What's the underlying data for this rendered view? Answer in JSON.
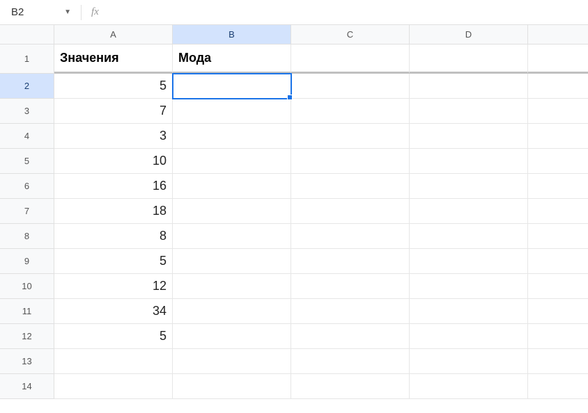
{
  "formulaBar": {
    "nameBox": "B2",
    "fx": "fx",
    "formula": ""
  },
  "columns": [
    "A",
    "B",
    "C",
    "D",
    ""
  ],
  "activeColumnIndex": 1,
  "activeRow": 2,
  "selectedCell": "B2",
  "rows": [
    {
      "n": 1,
      "header": true,
      "A": "Значения",
      "B": "Мода",
      "C": "",
      "D": ""
    },
    {
      "n": 2,
      "A": "5",
      "B": "",
      "C": "",
      "D": ""
    },
    {
      "n": 3,
      "A": "7",
      "B": "",
      "C": "",
      "D": ""
    },
    {
      "n": 4,
      "A": "3",
      "B": "",
      "C": "",
      "D": ""
    },
    {
      "n": 5,
      "A": "10",
      "B": "",
      "C": "",
      "D": ""
    },
    {
      "n": 6,
      "A": "16",
      "B": "",
      "C": "",
      "D": ""
    },
    {
      "n": 7,
      "A": "18",
      "B": "",
      "C": "",
      "D": ""
    },
    {
      "n": 8,
      "A": "8",
      "B": "",
      "C": "",
      "D": ""
    },
    {
      "n": 9,
      "A": "5",
      "B": "",
      "C": "",
      "D": ""
    },
    {
      "n": 10,
      "A": "12",
      "B": "",
      "C": "",
      "D": ""
    },
    {
      "n": 11,
      "A": "34",
      "B": "",
      "C": "",
      "D": ""
    },
    {
      "n": 12,
      "A": "5",
      "B": "",
      "C": "",
      "D": ""
    },
    {
      "n": 13,
      "A": "",
      "B": "",
      "C": "",
      "D": ""
    },
    {
      "n": 14,
      "A": "",
      "B": "",
      "C": "",
      "D": ""
    }
  ]
}
